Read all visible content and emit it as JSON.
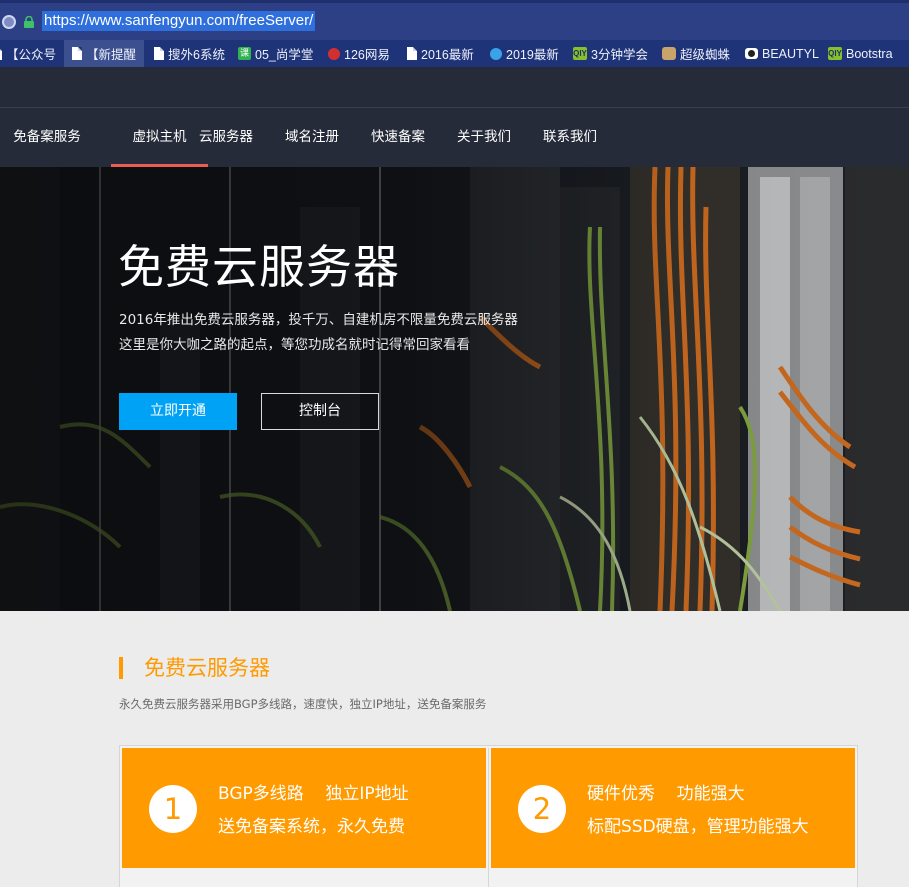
{
  "browser": {
    "url": "https://www.sanfengyun.com/freeServer/",
    "bookmarks": [
      {
        "label": "【公众号",
        "icon": "page-icon"
      },
      {
        "label": "【新提醒",
        "icon": "page-icon"
      },
      {
        "label": "搜外6系统",
        "icon": "page-icon"
      },
      {
        "label": "05_尚学堂",
        "icon": "course-icon"
      },
      {
        "label": "126网易",
        "icon": "netease-icon"
      },
      {
        "label": "2016最新",
        "icon": "page-icon"
      },
      {
        "label": "2019最新",
        "icon": "video-icon"
      },
      {
        "label": "3分钟学会",
        "icon": "iqiyi-icon"
      },
      {
        "label": "超级蜘蛛",
        "icon": "cat-icon"
      },
      {
        "label": "BEAUTYL",
        "icon": "camera-icon"
      },
      {
        "label": "Bootstra",
        "icon": "iqiyi-icon"
      }
    ],
    "course_icon_text": "课",
    "iqiyi_icon_text": "QIY"
  },
  "nav": {
    "items": [
      "免备案服务",
      "虚拟主机",
      "云服务器",
      "域名注册",
      "快速备案",
      "关于我们",
      "联系我们"
    ],
    "active_index": 1,
    "accent_color": "#e85e55"
  },
  "hero": {
    "title": "免费云服务器",
    "desc_line1": "2016年推出免费云服务器，投千万、自建机房不限量免费云服务器",
    "desc_line2": "这里是你大咖之路的起点，等您功成名就时记得常回家看看",
    "primary_button": "立即开通",
    "secondary_button": "控制台",
    "primary_color": "#00a2f5"
  },
  "section": {
    "title": "免费云服务器",
    "desc": "永久免费云服务器采用BGP多线路，速度快，独立IP地址，送免备案服务",
    "accent_color": "#ff9a00"
  },
  "cards": [
    {
      "number": "1",
      "line1": "BGP多线路    独立IP地址",
      "line2": "送免备案系统，永久免费"
    },
    {
      "number": "2",
      "line1": "硬件优秀    功能强大",
      "line2": "标配SSD硬盘，管理功能强大"
    }
  ]
}
